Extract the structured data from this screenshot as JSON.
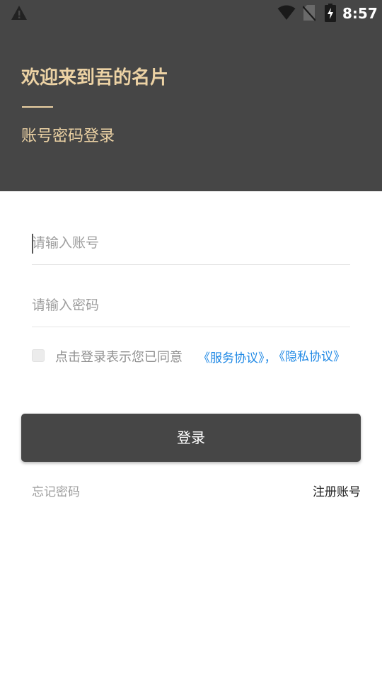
{
  "status_bar": {
    "time": "8:57",
    "icons": [
      "warning-icon",
      "wifi-icon",
      "no-sim-icon",
      "battery-charging-icon"
    ]
  },
  "header": {
    "welcome_title": "欢迎来到吾的名片",
    "subtitle": "账号密码登录"
  },
  "form": {
    "account_placeholder": "请输入账号",
    "password_placeholder": "请输入密码",
    "agreement_text": "点击登录表示您已同意",
    "service_link": "《服务协议》，",
    "privacy_link": "《隐私协议》",
    "login_label": "登录",
    "forgot_label": "忘记密码",
    "register_label": "注册账号"
  },
  "colors": {
    "header_bg": "#464646",
    "accent_gold": "#ecd2a4",
    "link_blue": "#1e88e5"
  }
}
